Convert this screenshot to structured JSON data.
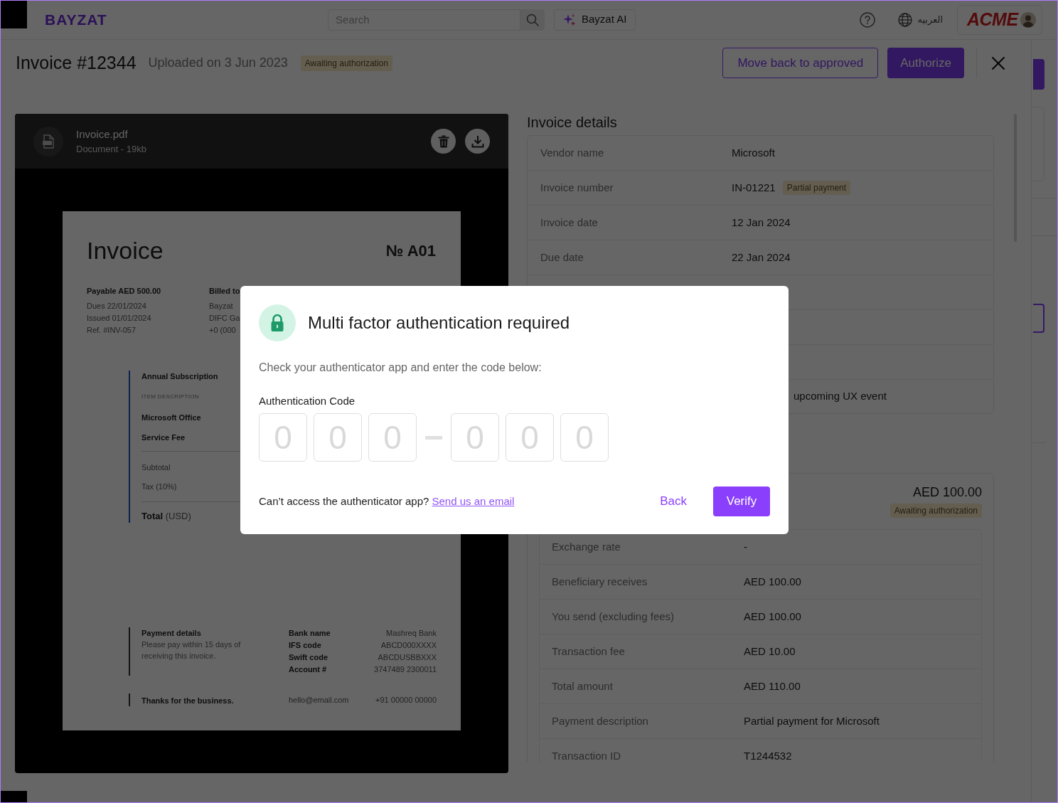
{
  "top_bar": {
    "logo": "BAYZAT",
    "search": {
      "placeholder": "Search"
    },
    "ai_button": "Bayzat AI",
    "language": "العربيه",
    "company_logo": "ACME"
  },
  "header": {
    "title": "Invoice #12344",
    "uploaded": "Uploaded on 3 Jun 2023",
    "status": "Awaiting authorization",
    "buttons": [
      {
        "label": "Move back to approved",
        "kind": "outline"
      },
      {
        "label": "Authorize",
        "kind": "primary"
      }
    ]
  },
  "document": {
    "file_name": "Invoice.pdf",
    "file_meta": "Document - 19kb",
    "page": {
      "title": "Invoice",
      "number": "№ A01",
      "payable": "Payable AED 500.00",
      "dates": [
        "Dues 22/01/2024",
        "Issued 01/01/2024",
        "Ref. #INV-057"
      ],
      "billed_to": {
        "heading": "Billed to",
        "lines": [
          "Bayzat",
          "DIFC Ga",
          "+0 (000"
        ]
      },
      "items": {
        "title": "Annual Subscription",
        "column": "ITEM DESCRIPTION",
        "rows": [
          "Microsoft Office",
          "Service Fee"
        ],
        "subtotal": "Subtotal",
        "tax": "Tax (10%)",
        "total": "**Total** (USD)"
      },
      "payment_details": {
        "heading": "Payment details",
        "note": "Please pay within 15 days of receiving this invoice.",
        "bank": [
          {
            "label": "Bank name",
            "value": "Mashreq Bank"
          },
          {
            "label": "IFS code",
            "value": "ABCD000XXXX"
          },
          {
            "label": "Swift code",
            "value": "ABCDUSBBXXX"
          },
          {
            "label": "Account #",
            "value": "3747489 2300011"
          }
        ]
      },
      "footer": {
        "thanks": "Thanks for the business.",
        "email": "hello@email.com",
        "phone": "+91 00000 00000"
      }
    }
  },
  "invoice_details": {
    "title": "Invoice details",
    "rows": [
      {
        "label": "Vendor name",
        "value": "Microsoft"
      },
      {
        "label": "Invoice number",
        "value": "IN-01221",
        "badge": "Partial payment"
      },
      {
        "label": "Invoice date",
        "value": "12 Jan 2024"
      },
      {
        "label": "Due date",
        "value": "22 Jan 2024"
      },
      {
        "value": "upcoming UX event"
      }
    ]
  },
  "payment": {
    "amount": "AED 100.00",
    "status": "Awaiting authorization",
    "rows": [
      {
        "label": "Exchange rate",
        "value": "-"
      },
      {
        "label": "Beneficiary receives",
        "value": "AED 100.00"
      },
      {
        "label": "You send (excluding fees)",
        "value": "AED 100.00"
      },
      {
        "label": "Transaction fee",
        "value": "AED 10.00"
      },
      {
        "label": "Total amount",
        "value": "AED 110.00"
      },
      {
        "label": "Payment description",
        "value": "Partial payment for Microsoft"
      },
      {
        "label": "Transaction ID",
        "value": "T1244532"
      }
    ]
  },
  "modal": {
    "title": "Multi factor authentication required",
    "text": "Check your authenticator app and enter the code below:",
    "code_label": "Authentication Code",
    "code_groups": [
      [
        {
          "placeholder": "0"
        },
        {
          "placeholder": "0"
        },
        {
          "placeholder": "0"
        }
      ],
      [
        {
          "placeholder": "0"
        },
        {
          "placeholder": "0"
        },
        {
          "placeholder": "0"
        }
      ]
    ],
    "help": {
      "text": "Can’t access the authenticator app?",
      "link": "Send us an email"
    },
    "buttons": [
      {
        "label": "Back",
        "kind": "text"
      },
      {
        "label": "Verify",
        "kind": "primary"
      }
    ]
  }
}
